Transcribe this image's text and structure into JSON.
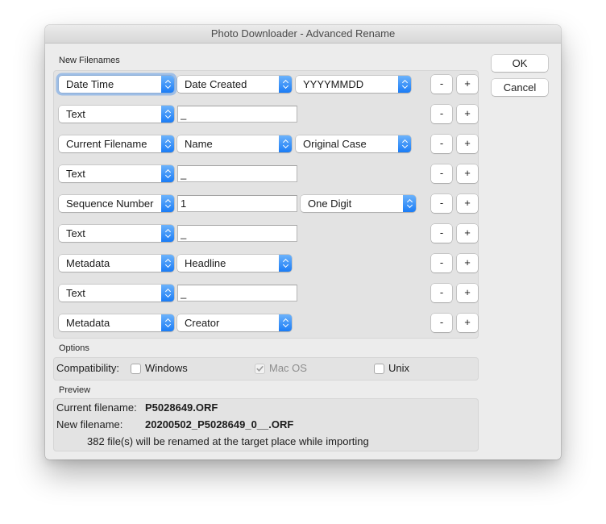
{
  "window": {
    "title": "Photo Downloader - Advanced Rename"
  },
  "sections": {
    "new_filenames": "New Filenames",
    "options": "Options",
    "preview": "Preview"
  },
  "rows": [
    {
      "element": "Date Time",
      "option": "Date Created",
      "format": "YYYYMMDD"
    },
    {
      "element": "Text",
      "text": "_"
    },
    {
      "element": "Current Filename",
      "option": "Name",
      "format": "Original Case"
    },
    {
      "element": "Text",
      "text": "_"
    },
    {
      "element": "Sequence Number",
      "text": "1",
      "format": "One Digit"
    },
    {
      "element": "Text",
      "text": "_"
    },
    {
      "element": "Metadata",
      "option": "Headline"
    },
    {
      "element": "Text",
      "text": "_"
    },
    {
      "element": "Metadata",
      "option": "Creator"
    }
  ],
  "row_buttons": {
    "remove": "-",
    "add": "+"
  },
  "buttons": {
    "ok": "OK",
    "cancel": "Cancel"
  },
  "options": {
    "compatibility_label": "Compatibility:",
    "windows": {
      "label": "Windows",
      "checked": false,
      "enabled": true
    },
    "macos": {
      "label": "Mac OS",
      "checked": true,
      "enabled": false
    },
    "unix": {
      "label": "Unix",
      "checked": false,
      "enabled": true
    }
  },
  "preview": {
    "current_label": "Current filename:",
    "current_value": "P5028649.ORF",
    "new_label": "New filename:",
    "new_value": "20200502_P5028649_0__.ORF",
    "summary": "382 file(s) will be renamed at the target place while importing"
  },
  "colors": {
    "accent": "#1a7cf6",
    "window_bg": "#ececec"
  }
}
